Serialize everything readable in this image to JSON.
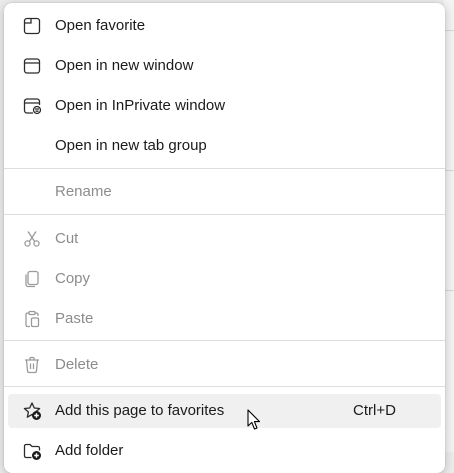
{
  "menu": {
    "items": [
      {
        "label": "Open favorite",
        "icon": "tab-icon",
        "enabled": true
      },
      {
        "label": "Open in new window",
        "icon": "window-icon",
        "enabled": true
      },
      {
        "label": "Open in InPrivate window",
        "icon": "inprivate-window-icon",
        "enabled": true
      },
      {
        "label": "Open in new tab group",
        "icon": "",
        "enabled": true
      },
      {
        "label": "Rename",
        "icon": "",
        "enabled": false
      },
      {
        "label": "Cut",
        "icon": "scissors-icon",
        "enabled": false
      },
      {
        "label": "Copy",
        "icon": "copy-icon",
        "enabled": false
      },
      {
        "label": "Paste",
        "icon": "clipboard-icon",
        "enabled": false
      },
      {
        "label": "Delete",
        "icon": "trash-icon",
        "enabled": false
      },
      {
        "label": "Add this page to favorites",
        "icon": "star-add-icon",
        "enabled": true,
        "shortcut": "Ctrl+D",
        "hovered": true
      },
      {
        "label": "Add folder",
        "icon": "folder-add-icon",
        "enabled": true
      }
    ]
  },
  "colors": {
    "menu_background": "#ffffff",
    "hover_background": "#f0f0f0",
    "text": "#1b1b1b",
    "disabled_text": "#8c8c8c",
    "divider": "#dedede"
  }
}
